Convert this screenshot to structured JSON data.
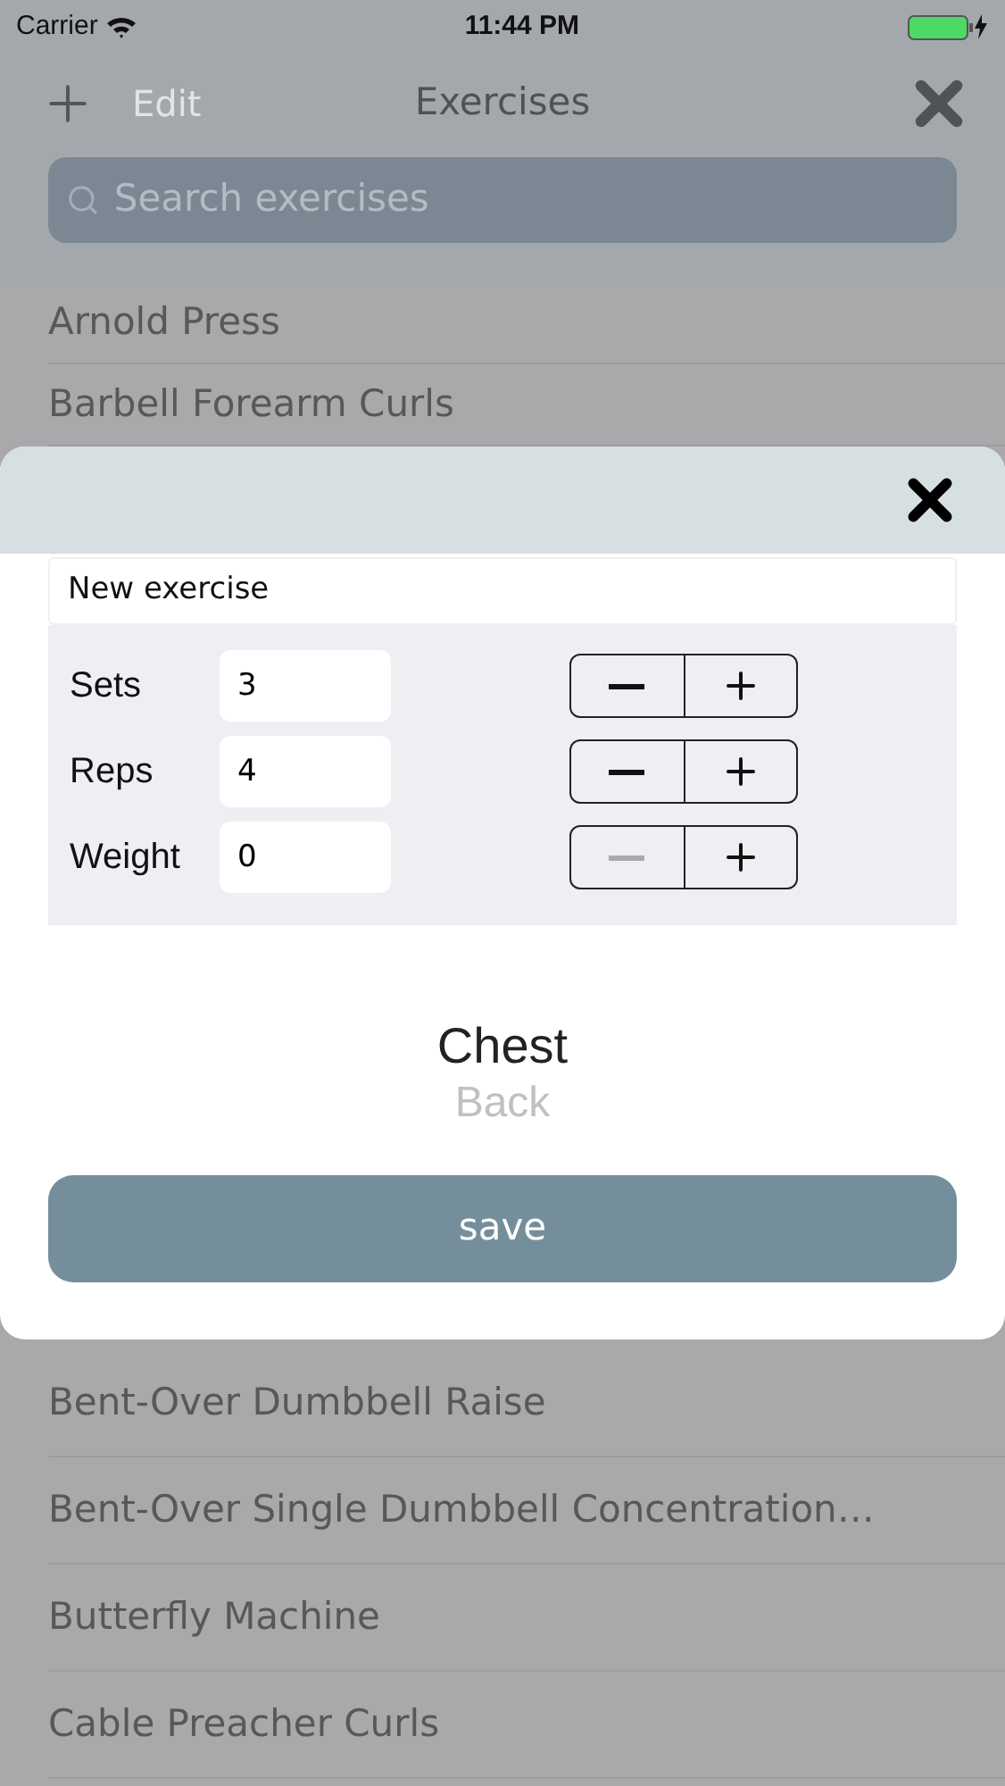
{
  "status_bar": {
    "carrier": "Carrier",
    "time": "11:44 PM"
  },
  "nav": {
    "edit": "Edit",
    "title": "Exercises"
  },
  "search": {
    "placeholder": "Search exercises"
  },
  "list_top": [
    "Arnold Press",
    "Barbell Forearm Curls"
  ],
  "list_bottom": [
    "Bent-Over Dumbbell Raise",
    "Bent-Over Single Dumbbell Concentration…",
    "Butterfly Machine",
    "Cable Preacher Curls"
  ],
  "modal": {
    "name": {
      "value": "New exercise"
    },
    "fields": [
      {
        "label": "Sets",
        "value": "3",
        "decrement_disabled": false
      },
      {
        "label": "Reps",
        "value": "4",
        "decrement_disabled": false
      },
      {
        "label": "Weight",
        "value": "0",
        "decrement_disabled": true
      }
    ],
    "picker": [
      {
        "label": "Chest",
        "selected": true
      },
      {
        "label": "Back",
        "selected": false
      }
    ],
    "save": "save"
  }
}
